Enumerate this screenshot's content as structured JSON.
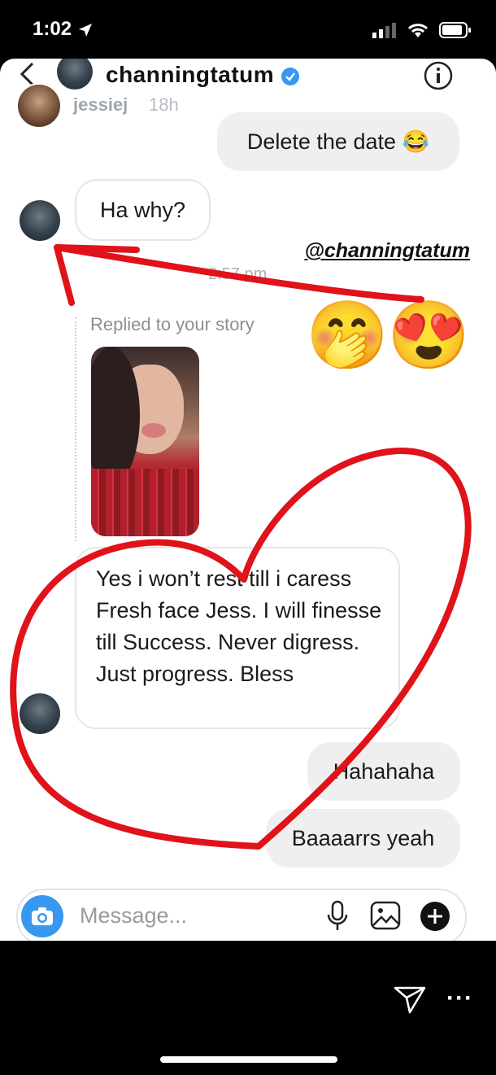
{
  "status": {
    "time": "1:02"
  },
  "story": {
    "header_username": "channingtatum",
    "story_username": "jessiej",
    "story_age": "18h"
  },
  "messages": [
    {
      "text": "Delete the date 😂"
    },
    {
      "text": "Ha why?"
    },
    {
      "text": "Yes i won’t rest till i caress Fresh face Jess. I will finesse till Success. Never digress. Just progress. Bless"
    },
    {
      "text": "Hahahaha"
    },
    {
      "text": "Baaaarrs yeah"
    }
  ],
  "timestamp": "2:57 pm",
  "reply_label": "Replied to your story",
  "mention": "@channingtatum",
  "stickers": [
    "🤭",
    "😍"
  ],
  "composer": {
    "placeholder": "Message..."
  },
  "colors": {
    "annotation_red": "#e0121a",
    "camera_blue": "#3897f0",
    "verified_blue": "#3897f0"
  },
  "icons": [
    "back-icon",
    "verified-icon",
    "info-icon",
    "close-icon",
    "camera-icon",
    "microphone-icon",
    "gallery-icon",
    "add-icon",
    "send-icon",
    "more-icon"
  ]
}
